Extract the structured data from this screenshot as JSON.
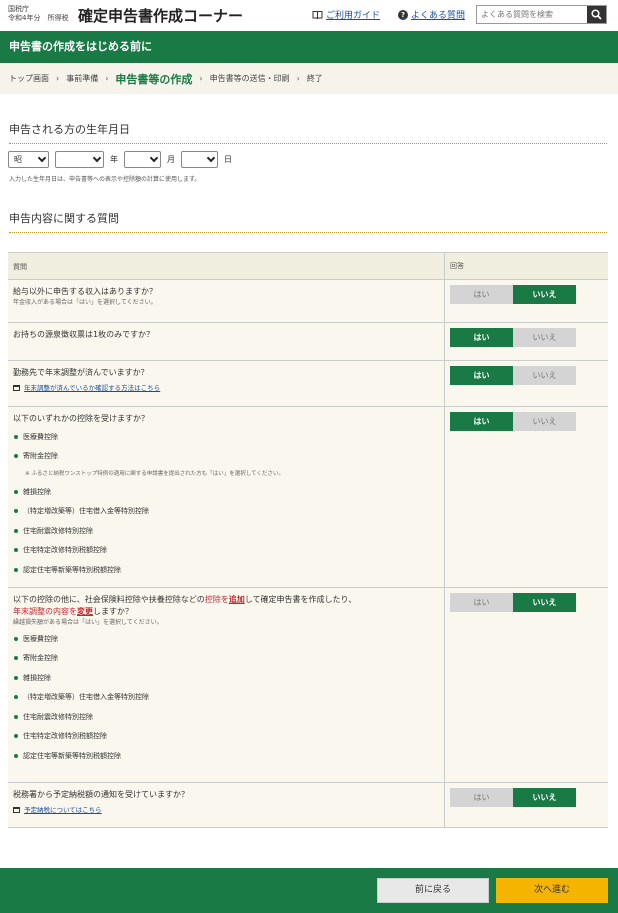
{
  "header": {
    "agency": "国税庁",
    "year_label": "令和4年分　所得税",
    "title": "確定申告書作成コーナー",
    "guide_link": "ご利用ガイド",
    "faq_link": "よくある質問",
    "search_placeholder": "よくある質問を検索"
  },
  "banner": "申告書の作成をはじめる前に",
  "breadcrumb": [
    "トップ画面",
    "事前準備",
    "申告書等の作成",
    "申告書等の送信・印刷",
    "終了"
  ],
  "birth": {
    "heading": "申告される方の生年月日",
    "era_value": "昭",
    "year_unit": "年",
    "month_unit": "月",
    "day_unit": "日",
    "note": "入力した生年月日は、申告書等への表示や控除額の計算に使用します。"
  },
  "questions_heading": "申告内容に関する質問",
  "table": {
    "col_question": "質問",
    "col_answer": "回答",
    "yes": "はい",
    "no": "いいえ",
    "q1": {
      "text": "給与以外に申告する収入はありますか？",
      "note": "年金収入がある場合は「はい」を選択してください。",
      "answer": "no"
    },
    "q2": {
      "text": "お持ちの源泉徴収票は1枚のみですか？",
      "answer": "yes"
    },
    "q3": {
      "text": "勤務先で年末調整が済んでいますか？",
      "link": "年末調整が済んでいるか確認する方法はこちら",
      "answer": "yes"
    },
    "q4": {
      "text": "以下のいずれかの控除を受けますか？",
      "answer": "yes",
      "items": [
        "医療費控除",
        "寄附金控除",
        "雑損控除",
        "（特定増改築等）住宅借入金等特別控除",
        "住宅耐震改修特別控除",
        "住宅特定改修特別税額控除",
        "認定住宅等新築等特別税額控除"
      ],
      "subnote": "※ ふるさと納税ワンストップ特例の適用に関する申請書を提出された方も「はい」を選択してください。"
    },
    "q5": {
      "text_a": "以下の控除の他に、社会保険料控除や扶養控除などの",
      "text_b": "控除を",
      "text_c": "追加",
      "text_d": "して確定申告書を作成したり、",
      "text_e": "年末調整の内容を",
      "text_f": "変更",
      "text_g": "しますか？",
      "note": "繰越損失額がある場合は「はい」を選択してください。",
      "answer": "no",
      "items": [
        "医療費控除",
        "寄附金控除",
        "雑損控除",
        "（特定増改築等）住宅借入金等特別控除",
        "住宅耐震改修特別控除",
        "住宅特定改修特別税額控除",
        "認定住宅等新築等特別税額控除"
      ]
    },
    "q6": {
      "text": "税務署から予定納税額の通知を受けていますか？",
      "link": "予定納税についてはこちら",
      "answer": "no"
    }
  },
  "footer": {
    "back": "前に戻る",
    "next": "次へ進む"
  },
  "colors": {
    "brand_green": "#1a7a45",
    "next_button": "#f5b400",
    "accent_red": "#c1272d"
  }
}
